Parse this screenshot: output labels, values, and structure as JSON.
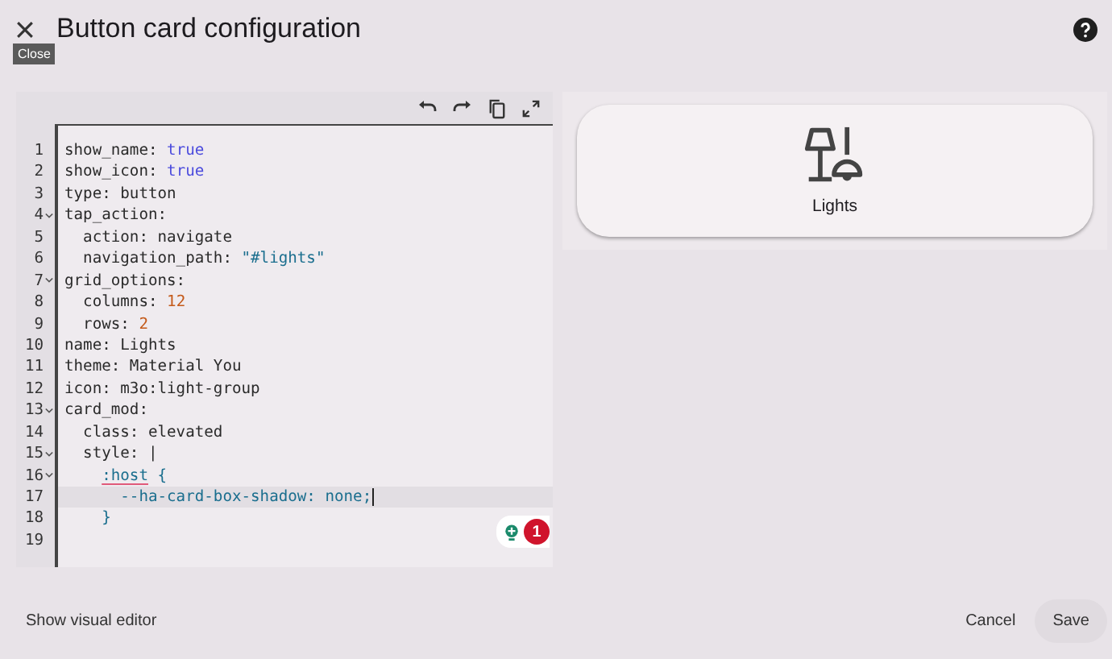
{
  "dialog": {
    "title": "Button card configuration",
    "close_tooltip": "Close"
  },
  "editor": {
    "lines": [
      {
        "number": "1",
        "fold": false,
        "active": false,
        "tokens": [
          {
            "text": "show_name: ",
            "kind": "key"
          },
          {
            "text": "true",
            "kind": "bool"
          }
        ]
      },
      {
        "number": "2",
        "fold": false,
        "active": false,
        "tokens": [
          {
            "text": "show_icon: ",
            "kind": "key"
          },
          {
            "text": "true",
            "kind": "bool"
          }
        ]
      },
      {
        "number": "3",
        "fold": false,
        "active": false,
        "tokens": [
          {
            "text": "type: button",
            "kind": "key"
          }
        ]
      },
      {
        "number": "4",
        "fold": true,
        "active": false,
        "tokens": [
          {
            "text": "tap_action:",
            "kind": "key"
          }
        ]
      },
      {
        "number": "5",
        "fold": false,
        "active": false,
        "tokens": [
          {
            "text": "  action: navigate",
            "kind": "key"
          }
        ]
      },
      {
        "number": "6",
        "fold": false,
        "active": false,
        "tokens": [
          {
            "text": "  navigation_path: ",
            "kind": "key"
          },
          {
            "text": "\"#lights\"",
            "kind": "string"
          }
        ]
      },
      {
        "number": "7",
        "fold": true,
        "active": false,
        "tokens": [
          {
            "text": "grid_options:",
            "kind": "key"
          }
        ]
      },
      {
        "number": "8",
        "fold": false,
        "active": false,
        "tokens": [
          {
            "text": "  columns: ",
            "kind": "key"
          },
          {
            "text": "12",
            "kind": "number"
          }
        ]
      },
      {
        "number": "9",
        "fold": false,
        "active": false,
        "tokens": [
          {
            "text": "  rows: ",
            "kind": "key"
          },
          {
            "text": "2",
            "kind": "number"
          }
        ]
      },
      {
        "number": "10",
        "fold": false,
        "active": false,
        "tokens": [
          {
            "text": "name: Lights",
            "kind": "key"
          }
        ]
      },
      {
        "number": "11",
        "fold": false,
        "active": false,
        "tokens": [
          {
            "text": "theme: Material You",
            "kind": "key"
          }
        ]
      },
      {
        "number": "12",
        "fold": false,
        "active": false,
        "tokens": [
          {
            "text": "icon: m3o:light-group",
            "kind": "key"
          }
        ]
      },
      {
        "number": "13",
        "fold": true,
        "active": false,
        "tokens": [
          {
            "text": "card_mod:",
            "kind": "key"
          }
        ]
      },
      {
        "number": "14",
        "fold": false,
        "active": false,
        "tokens": [
          {
            "text": "  class: elevated",
            "kind": "key"
          }
        ]
      },
      {
        "number": "15",
        "fold": true,
        "active": false,
        "tokens": [
          {
            "text": "  style: |",
            "kind": "key"
          }
        ]
      },
      {
        "number": "16",
        "fold": true,
        "active": false,
        "tokens": [
          {
            "text": "    :host",
            "kind": "error"
          },
          {
            "text": " {",
            "kind": "css"
          }
        ]
      },
      {
        "number": "17",
        "fold": false,
        "active": true,
        "tokens": [
          {
            "text": "      --ha-card-box-shadow: none;",
            "kind": "css"
          }
        ]
      },
      {
        "number": "18",
        "fold": false,
        "active": false,
        "tokens": [
          {
            "text": "    }",
            "kind": "css"
          }
        ]
      },
      {
        "number": "19",
        "fold": false,
        "active": false
      }
    ],
    "lint_count": "1"
  },
  "preview": {
    "card_name": "Lights"
  },
  "footer": {
    "left_button": "Show visual editor",
    "buttons": [
      "Cancel",
      "Save"
    ]
  }
}
